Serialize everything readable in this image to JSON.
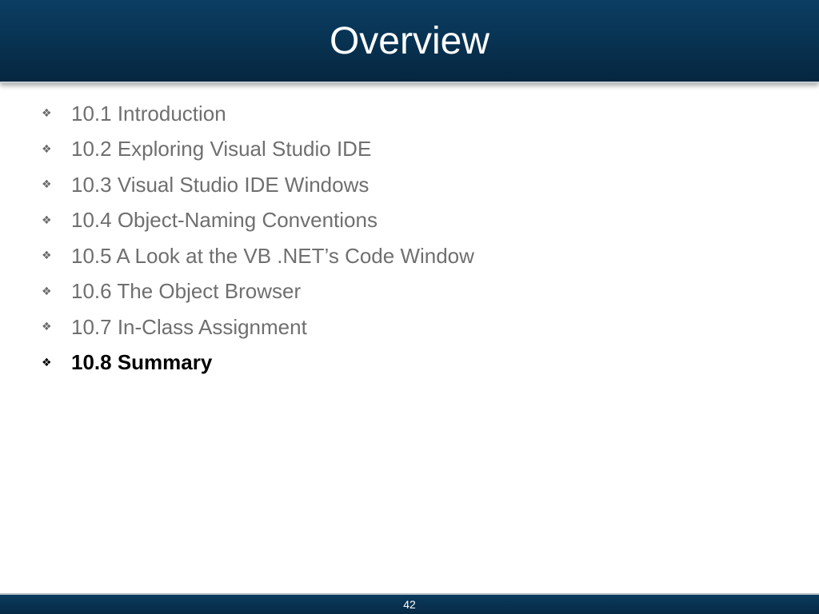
{
  "slide": {
    "title": "Overview",
    "page_number": "42",
    "bullet_icon": "four-diamond-bullet-icon",
    "colors": {
      "header_bg": "#083454",
      "bullet_text": "#6f6f6f",
      "active_text": "#000000",
      "title_text": "#ffffff"
    },
    "bullets": [
      {
        "label": "10.1 Introduction",
        "active": false
      },
      {
        "label": "10.2 Exploring Visual Studio IDE",
        "active": false
      },
      {
        "label": "10.3 Visual Studio IDE Windows",
        "active": false
      },
      {
        "label": "10.4 Object-Naming Conventions",
        "active": false
      },
      {
        "label": "10.5 A Look at the VB .NET’s Code Window",
        "active": false
      },
      {
        "label": "10.6 The Object Browser",
        "active": false
      },
      {
        "label": "10.7 In-Class Assignment",
        "active": false
      },
      {
        "label": "10.8 Summary",
        "active": true
      }
    ]
  }
}
